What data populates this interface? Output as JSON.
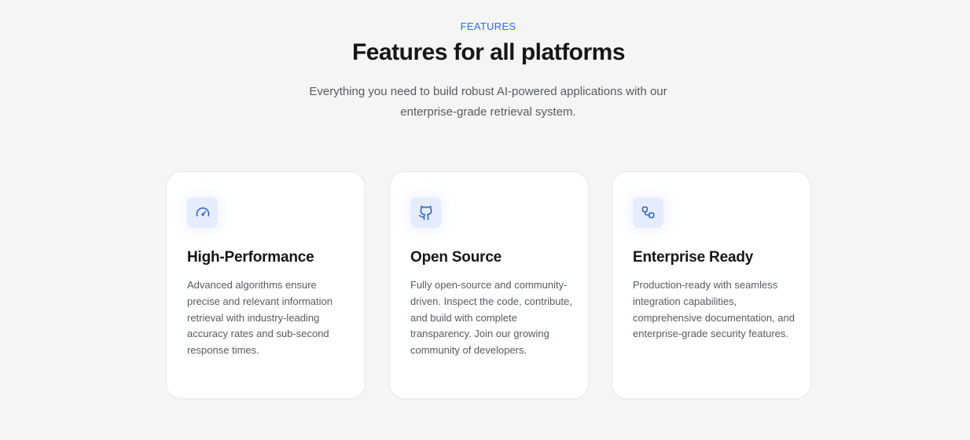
{
  "header": {
    "eyebrow": "FEATURES",
    "title": "Features for all platforms",
    "subtitle": "Everything you need to build robust AI-powered applications with our enterprise-grade retrieval system."
  },
  "colors": {
    "accent": "#2f6fdf",
    "icon_tile_bg": "#e4ecfd",
    "icon_stroke": "#2f5fb8",
    "page_bg": "#f5f5f5",
    "card_bg": "#ffffff"
  },
  "features": [
    {
      "icon": "gauge-icon",
      "title": "High-Performance",
      "description": "Advanced algorithms ensure precise and relevant information retrieval with industry-leading accuracy rates and sub-second response times."
    },
    {
      "icon": "github-icon",
      "title": "Open Source",
      "description": "Fully open-source and community-driven. Inspect the code, contribute, and build with complete transparency. Join our growing community of developers."
    },
    {
      "icon": "workflow-icon",
      "title": "Enterprise Ready",
      "description": "Production-ready with seamless integration capabilities, comprehensive documentation, and enterprise-grade security features."
    }
  ]
}
